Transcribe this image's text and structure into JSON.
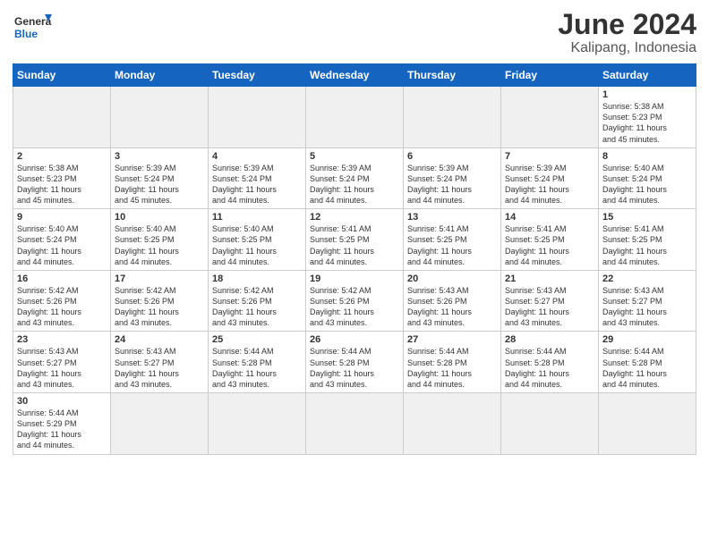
{
  "logo": {
    "text_general": "General",
    "text_blue": "Blue"
  },
  "title": {
    "month_year": "June 2024",
    "location": "Kalipang, Indonesia"
  },
  "weekdays": [
    "Sunday",
    "Monday",
    "Tuesday",
    "Wednesday",
    "Thursday",
    "Friday",
    "Saturday"
  ],
  "weeks": [
    [
      {
        "day": "",
        "empty": true
      },
      {
        "day": "",
        "empty": true
      },
      {
        "day": "",
        "empty": true
      },
      {
        "day": "",
        "empty": true
      },
      {
        "day": "",
        "empty": true
      },
      {
        "day": "",
        "empty": true
      },
      {
        "day": "1",
        "info": "Sunrise: 5:38 AM\nSunset: 5:23 PM\nDaylight: 11 hours\nand 45 minutes."
      }
    ],
    [
      {
        "day": "2",
        "info": "Sunrise: 5:38 AM\nSunset: 5:23 PM\nDaylight: 11 hours\nand 45 minutes."
      },
      {
        "day": "3",
        "info": "Sunrise: 5:39 AM\nSunset: 5:24 PM\nDaylight: 11 hours\nand 45 minutes."
      },
      {
        "day": "4",
        "info": "Sunrise: 5:39 AM\nSunset: 5:24 PM\nDaylight: 11 hours\nand 44 minutes."
      },
      {
        "day": "5",
        "info": "Sunrise: 5:39 AM\nSunset: 5:24 PM\nDaylight: 11 hours\nand 44 minutes."
      },
      {
        "day": "6",
        "info": "Sunrise: 5:39 AM\nSunset: 5:24 PM\nDaylight: 11 hours\nand 44 minutes."
      },
      {
        "day": "7",
        "info": "Sunrise: 5:39 AM\nSunset: 5:24 PM\nDaylight: 11 hours\nand 44 minutes."
      },
      {
        "day": "8",
        "info": "Sunrise: 5:40 AM\nSunset: 5:24 PM\nDaylight: 11 hours\nand 44 minutes."
      }
    ],
    [
      {
        "day": "9",
        "info": "Sunrise: 5:40 AM\nSunset: 5:24 PM\nDaylight: 11 hours\nand 44 minutes."
      },
      {
        "day": "10",
        "info": "Sunrise: 5:40 AM\nSunset: 5:25 PM\nDaylight: 11 hours\nand 44 minutes."
      },
      {
        "day": "11",
        "info": "Sunrise: 5:40 AM\nSunset: 5:25 PM\nDaylight: 11 hours\nand 44 minutes."
      },
      {
        "day": "12",
        "info": "Sunrise: 5:41 AM\nSunset: 5:25 PM\nDaylight: 11 hours\nand 44 minutes."
      },
      {
        "day": "13",
        "info": "Sunrise: 5:41 AM\nSunset: 5:25 PM\nDaylight: 11 hours\nand 44 minutes."
      },
      {
        "day": "14",
        "info": "Sunrise: 5:41 AM\nSunset: 5:25 PM\nDaylight: 11 hours\nand 44 minutes."
      },
      {
        "day": "15",
        "info": "Sunrise: 5:41 AM\nSunset: 5:25 PM\nDaylight: 11 hours\nand 44 minutes."
      }
    ],
    [
      {
        "day": "16",
        "info": "Sunrise: 5:42 AM\nSunset: 5:26 PM\nDaylight: 11 hours\nand 43 minutes."
      },
      {
        "day": "17",
        "info": "Sunrise: 5:42 AM\nSunset: 5:26 PM\nDaylight: 11 hours\nand 43 minutes."
      },
      {
        "day": "18",
        "info": "Sunrise: 5:42 AM\nSunset: 5:26 PM\nDaylight: 11 hours\nand 43 minutes."
      },
      {
        "day": "19",
        "info": "Sunrise: 5:42 AM\nSunset: 5:26 PM\nDaylight: 11 hours\nand 43 minutes."
      },
      {
        "day": "20",
        "info": "Sunrise: 5:43 AM\nSunset: 5:26 PM\nDaylight: 11 hours\nand 43 minutes."
      },
      {
        "day": "21",
        "info": "Sunrise: 5:43 AM\nSunset: 5:27 PM\nDaylight: 11 hours\nand 43 minutes."
      },
      {
        "day": "22",
        "info": "Sunrise: 5:43 AM\nSunset: 5:27 PM\nDaylight: 11 hours\nand 43 minutes."
      }
    ],
    [
      {
        "day": "23",
        "info": "Sunrise: 5:43 AM\nSunset: 5:27 PM\nDaylight: 11 hours\nand 43 minutes."
      },
      {
        "day": "24",
        "info": "Sunrise: 5:43 AM\nSunset: 5:27 PM\nDaylight: 11 hours\nand 43 minutes."
      },
      {
        "day": "25",
        "info": "Sunrise: 5:44 AM\nSunset: 5:28 PM\nDaylight: 11 hours\nand 43 minutes."
      },
      {
        "day": "26",
        "info": "Sunrise: 5:44 AM\nSunset: 5:28 PM\nDaylight: 11 hours\nand 43 minutes."
      },
      {
        "day": "27",
        "info": "Sunrise: 5:44 AM\nSunset: 5:28 PM\nDaylight: 11 hours\nand 44 minutes."
      },
      {
        "day": "28",
        "info": "Sunrise: 5:44 AM\nSunset: 5:28 PM\nDaylight: 11 hours\nand 44 minutes."
      },
      {
        "day": "29",
        "info": "Sunrise: 5:44 AM\nSunset: 5:28 PM\nDaylight: 11 hours\nand 44 minutes."
      }
    ],
    [
      {
        "day": "30",
        "info": "Sunrise: 5:44 AM\nSunset: 5:29 PM\nDaylight: 11 hours\nand 44 minutes."
      },
      {
        "day": "",
        "empty": true
      },
      {
        "day": "",
        "empty": true
      },
      {
        "day": "",
        "empty": true
      },
      {
        "day": "",
        "empty": true
      },
      {
        "day": "",
        "empty": true
      },
      {
        "day": "",
        "empty": true
      }
    ]
  ]
}
